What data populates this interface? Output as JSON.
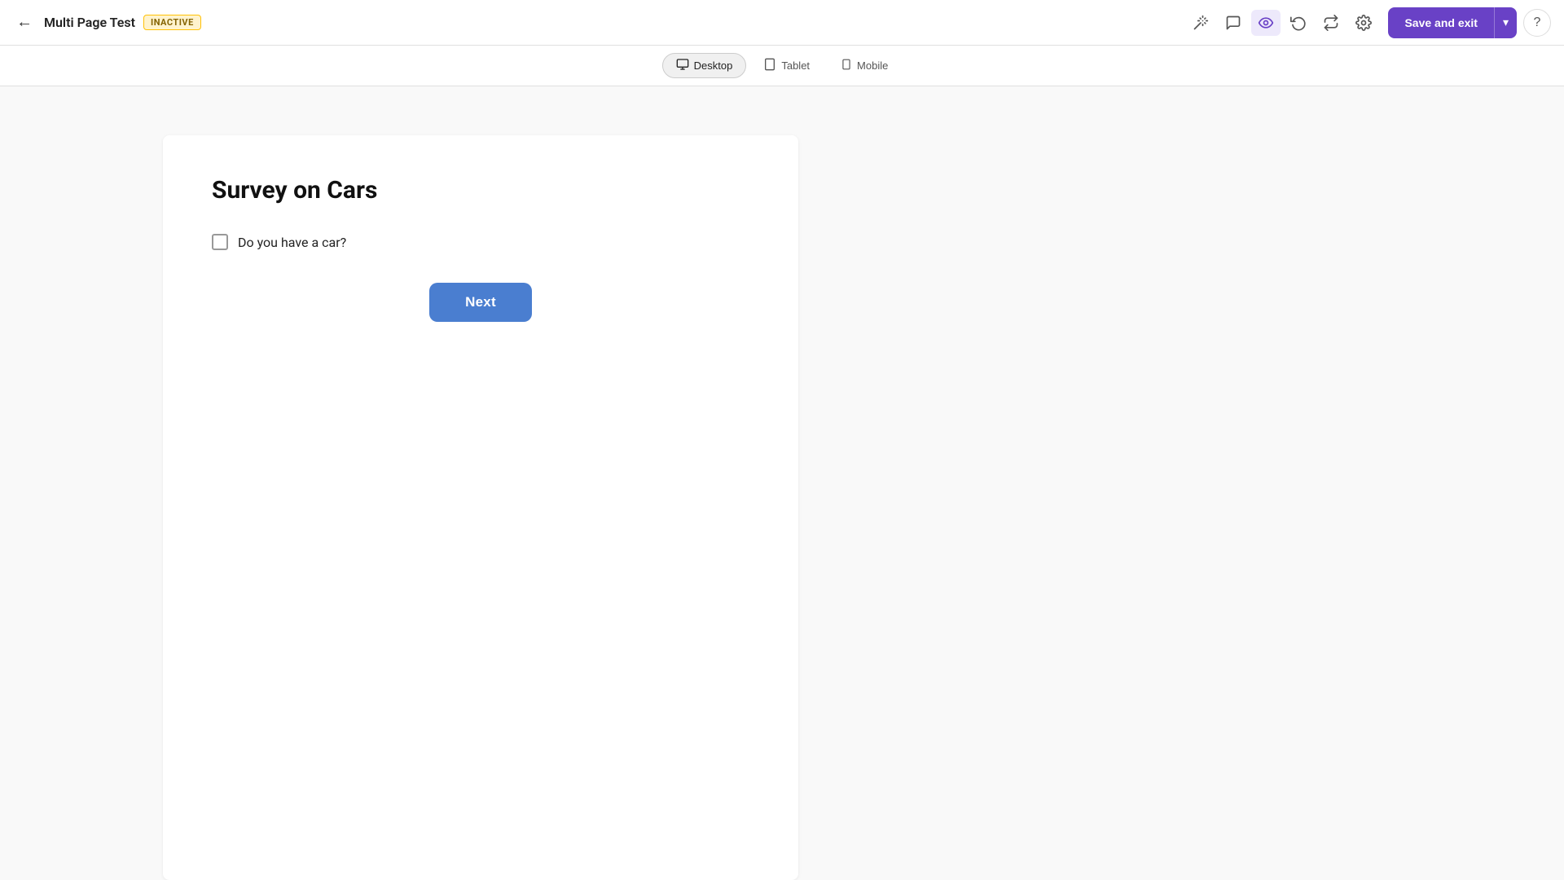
{
  "header": {
    "back_label": "←",
    "title": "Multi Page Test",
    "status": "INACTIVE",
    "icons": {
      "magic": "✦",
      "comment": "💬",
      "eye": "👁",
      "history": "🕐",
      "flow": "⇄",
      "settings": "⚙"
    },
    "save_exit_label": "Save and exit",
    "dropdown_arrow": "▾",
    "help_label": "?"
  },
  "device_bar": {
    "options": [
      {
        "id": "desktop",
        "icon": "🖥",
        "label": "Desktop",
        "active": true
      },
      {
        "id": "tablet",
        "icon": "⬜",
        "label": "Tablet",
        "active": false
      },
      {
        "id": "mobile",
        "icon": "📱",
        "label": "Mobile",
        "active": false
      }
    ]
  },
  "survey": {
    "title": "Survey on Cars",
    "question_label": "Do you have a car?",
    "next_button": "Next"
  }
}
